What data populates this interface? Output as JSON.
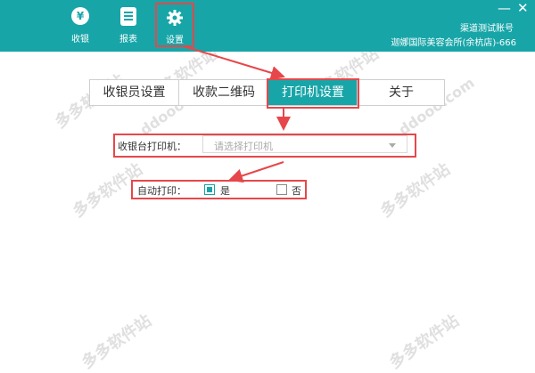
{
  "topbar": {
    "nav": [
      {
        "icon": "yen-icon",
        "glyph": "¥",
        "label": "收银"
      },
      {
        "icon": "report-icon",
        "label": "报表"
      },
      {
        "icon": "gear-icon",
        "label": "设置"
      }
    ],
    "account": {
      "name": "渠道测试账号",
      "store": "迦娜国际美容会所(余杭店)-666"
    },
    "minimize_glyph": "—",
    "close_glyph": "✕"
  },
  "tabs": [
    "收银员设置",
    "收款二维码",
    "打印机设置",
    "关于"
  ],
  "active_tab": "打印机设置",
  "printer": {
    "label": "收银台打印机：",
    "placeholder": "请选择打印机"
  },
  "auto_print": {
    "label": "自动打印：",
    "yes": "是",
    "no": "否",
    "selected": "是"
  },
  "watermark": [
    "多多软件站",
    "ddooo.com"
  ],
  "colors": {
    "accent": "#18a5a8",
    "annotation": "#e6474a"
  }
}
